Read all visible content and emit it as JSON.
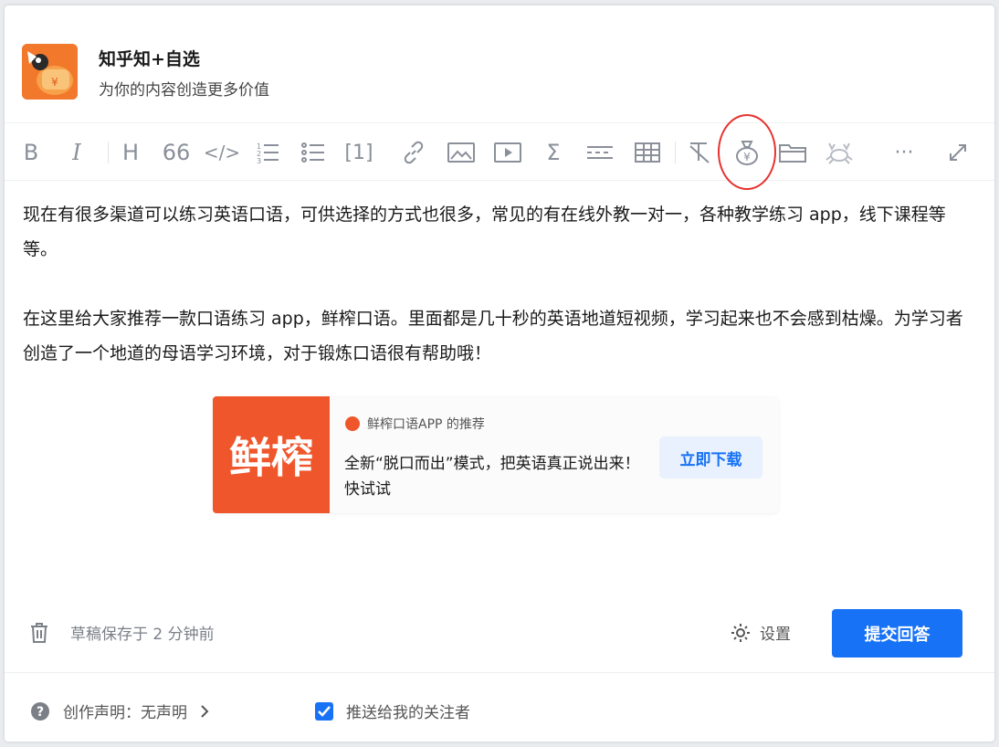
{
  "header": {
    "app_name": "知乎知+自选",
    "slogan": "为你的内容创造更多价值"
  },
  "toolbar": {
    "items": [
      {
        "name": "bold",
        "glyph": "B"
      },
      {
        "name": "italic",
        "glyph": "I"
      },
      {
        "name": "heading",
        "glyph": "H"
      },
      {
        "name": "quote",
        "glyph": "66"
      },
      {
        "name": "code",
        "glyph": "</>"
      },
      {
        "name": "ordered-list",
        "glyph": ""
      },
      {
        "name": "unordered-list",
        "glyph": ""
      },
      {
        "name": "footnote",
        "glyph": "[1]"
      },
      {
        "name": "link",
        "glyph": ""
      },
      {
        "name": "image",
        "glyph": ""
      },
      {
        "name": "video",
        "glyph": ""
      },
      {
        "name": "formula",
        "glyph": "Σ"
      },
      {
        "name": "divider",
        "glyph": ""
      },
      {
        "name": "table",
        "glyph": ""
      },
      {
        "name": "clear-format",
        "glyph": ""
      },
      {
        "name": "money-bag",
        "glyph": ""
      },
      {
        "name": "folder",
        "glyph": ""
      },
      {
        "name": "crab",
        "glyph": ""
      },
      {
        "name": "more",
        "glyph": "···"
      },
      {
        "name": "expand",
        "glyph": ""
      }
    ],
    "highlight_color": "#e6322e"
  },
  "content": {
    "paragraph_1": "现在有很多渠道可以练习英语口语，可供选择的方式也很多，常见的有在线外教一对一，各种教学练习 app，线下课程等等。",
    "paragraph_2": "在这里给大家推荐一款口语练习 app，鲜榨口语。里面都是几十秒的英语地道短视频，学习起来也不会感到枯燥。为学习者创造了一个地道的母语学习环境，对于锻炼口语很有帮助哦！"
  },
  "ad_card": {
    "image_text": "鲜榨",
    "source": "鲜榨口语APP 的推荐",
    "description": "全新“脱口而出”模式，把英语真正说出来！快试试",
    "button_label": "立即下载",
    "brand_color": "#f0562c"
  },
  "footer": {
    "draft_status": "草稿保存于 2 分钟前",
    "settings_label": "设置",
    "submit_label": "提交回答",
    "declaration_label": "创作声明：无声明",
    "push_label": "推送给我的关注者",
    "push_checked": true,
    "accent": "#1772f6"
  }
}
